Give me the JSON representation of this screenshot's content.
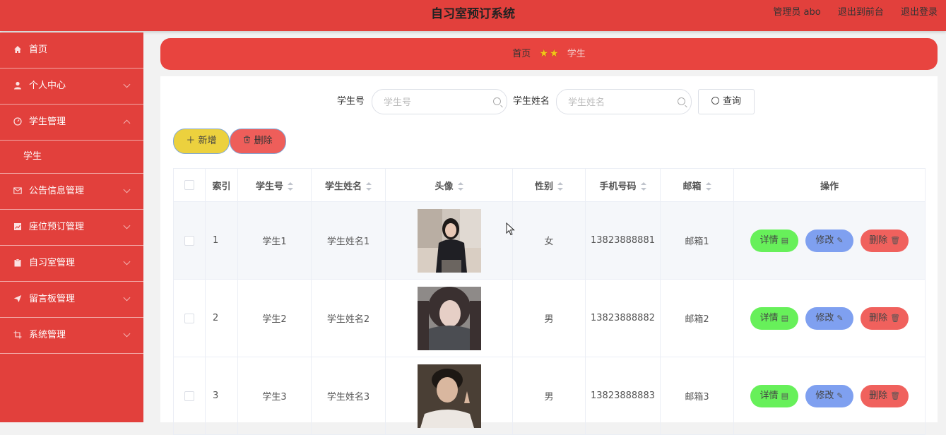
{
  "header": {
    "title": "自习室预订系统",
    "admin": "管理员 abo",
    "to_front": "退出到前台",
    "logout": "退出登录"
  },
  "sidebar": {
    "items": [
      {
        "label": "首页",
        "icon": "home-icon"
      },
      {
        "label": "个人中心",
        "icon": "user-icon"
      },
      {
        "label": "学生管理",
        "icon": "compass-icon",
        "sub": "学生"
      },
      {
        "label": "公告信息管理",
        "icon": "mail-icon"
      },
      {
        "label": "座位预订管理",
        "icon": "chart-icon"
      },
      {
        "label": "自习室管理",
        "icon": "clipboard-icon"
      },
      {
        "label": "留言板管理",
        "icon": "send-icon"
      },
      {
        "label": "系统管理",
        "icon": "crop-icon"
      }
    ]
  },
  "breadcrumb": {
    "home": "首页",
    "current": "学生"
  },
  "search": {
    "student_no_label": "学生号",
    "student_no_placeholder": "学生号",
    "student_name_label": "学生姓名",
    "student_name_placeholder": "学生姓名",
    "query_label": "查询"
  },
  "actions": {
    "add_label": "＋ 新增",
    "delete_label": "删除"
  },
  "table": {
    "columns": [
      "索引",
      "学生号",
      "学生姓名",
      "头像",
      "性别",
      "手机号码",
      "邮箱",
      "操作"
    ],
    "rows": [
      {
        "index": "1",
        "student_no": "学生1",
        "name": "学生姓名1",
        "gender": "女",
        "phone": "13823888881",
        "email": "邮箱1"
      },
      {
        "index": "2",
        "student_no": "学生2",
        "name": "学生姓名2",
        "gender": "男",
        "phone": "13823888882",
        "email": "邮箱2"
      },
      {
        "index": "3",
        "student_no": "学生3",
        "name": "学生姓名3",
        "gender": "男",
        "phone": "13823888883",
        "email": "邮箱3"
      }
    ],
    "op_detail": "详情",
    "op_edit": "修改",
    "op_delete": "删除"
  },
  "colors": {
    "primary": "#e2403c",
    "add": "#ecd13e",
    "detail": "#67f05a",
    "edit": "#7fa0f0",
    "delete": "#f0615d"
  }
}
